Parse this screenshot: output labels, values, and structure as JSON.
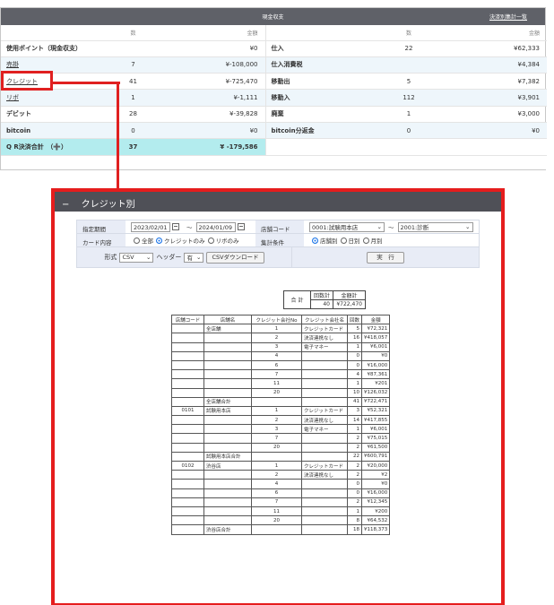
{
  "summary": {
    "title": "現金収支",
    "link": "決済別集計一覧",
    "col_count": "数",
    "col_amount": "金額",
    "left": [
      {
        "label": "使用ポイント（現金収支）",
        "count": "",
        "amount": "¥0"
      },
      {
        "label": "売掛",
        "count": "7",
        "amount": "¥-108,000"
      },
      {
        "label": "クレジット",
        "count": "41",
        "amount": "¥-725,470"
      },
      {
        "label": "リボ",
        "count": "1",
        "amount": "¥-1,111"
      },
      {
        "label": "デビット",
        "count": "28",
        "amount": "¥-39,828"
      },
      {
        "label": "bitcoin",
        "count": "0",
        "amount": "¥0"
      },
      {
        "label": "Q R決済合計　（➕）",
        "count": "37",
        "amount": "¥ -179,586"
      }
    ],
    "right": [
      {
        "label": "仕入",
        "count": "22",
        "amount": "¥62,333"
      },
      {
        "label": "仕入消費税",
        "count": "",
        "amount": "¥4,384"
      },
      {
        "label": "移動出",
        "count": "5",
        "amount": "¥7,382"
      },
      {
        "label": "移動入",
        "count": "112",
        "amount": "¥3,901"
      },
      {
        "label": "廃棄",
        "count": "1",
        "amount": "¥3,000"
      },
      {
        "label": "bitcoin分返金",
        "count": "0",
        "amount": "¥0"
      }
    ]
  },
  "credit": {
    "section_title": "クレジット別",
    "collapse_icon": "minus-icon",
    "filters": {
      "period_label": "指定期間",
      "date_from": "2023/02/01",
      "tilde": "〜",
      "date_to": "2024/01/09",
      "store_code_label": "店舗コード",
      "store_from": "0001:試験用本店",
      "store_to": "2001:診断",
      "card_label": "カード内容",
      "card_options": [
        "全部",
        "クレジットのみ",
        "リボのみ"
      ],
      "agg_label": "集計条件",
      "agg_options": [
        "店舗別",
        "日別",
        "月別"
      ],
      "format_label": "形式",
      "format_value": "CSV",
      "header_label": "ヘッダー",
      "header_value": "有",
      "csv_button": "CSVダウンロード",
      "run_button": "実　行"
    },
    "totals": {
      "label": "合 計",
      "count_label": "回数計",
      "amount_label": "金額計",
      "count": "40",
      "amount": "¥722,470"
    },
    "headers": [
      "店舗コード",
      "店舗名",
      "クレジット会社No",
      "クレジット会社名",
      "回数",
      "金額"
    ],
    "rows": [
      [
        "",
        "全店舗",
        "1",
        "クレジットカード",
        "5",
        "¥72,321"
      ],
      [
        "",
        "",
        "2",
        "決済連携なし",
        "16",
        "¥418,057"
      ],
      [
        "",
        "",
        "3",
        "電子マネー",
        "1",
        "¥6,001"
      ],
      [
        "",
        "",
        "4",
        "",
        "0",
        "¥0"
      ],
      [
        "",
        "",
        "6",
        "",
        "0",
        "¥16,000"
      ],
      [
        "",
        "",
        "7",
        "",
        "4",
        "¥87,361"
      ],
      [
        "",
        "",
        "11",
        "",
        "1",
        "¥201"
      ],
      [
        "",
        "",
        "20",
        "",
        "10",
        "¥126,032"
      ],
      [
        "",
        "全店舗合計",
        "",
        "",
        "41",
        "¥722,471"
      ],
      [
        "0101",
        "試験用本店",
        "1",
        "クレジットカード",
        "3",
        "¥52,321"
      ],
      [
        "",
        "",
        "2",
        "決済連携なし",
        "14",
        "¥417,855"
      ],
      [
        "",
        "",
        "3",
        "電子マネー",
        "1",
        "¥6,001"
      ],
      [
        "",
        "",
        "7",
        "",
        "2",
        "¥75,015"
      ],
      [
        "",
        "",
        "20",
        "",
        "2",
        "¥61,500"
      ],
      [
        "",
        "試験用本店合計",
        "",
        "",
        "22",
        "¥600,791"
      ],
      [
        "0102",
        "渋谷店",
        "1",
        "クレジットカード",
        "2",
        "¥20,000"
      ],
      [
        "",
        "",
        "2",
        "決済連携なし",
        "2",
        "¥2"
      ],
      [
        "",
        "",
        "4",
        "",
        "0",
        "¥0"
      ],
      [
        "",
        "",
        "6",
        "",
        "0",
        "¥16,000"
      ],
      [
        "",
        "",
        "7",
        "",
        "2",
        "¥12,345"
      ],
      [
        "",
        "",
        "11",
        "",
        "1",
        "¥200"
      ],
      [
        "",
        "",
        "20",
        "",
        "8",
        "¥64,532"
      ],
      [
        "",
        "渋谷店合計",
        "",
        "",
        "18",
        "¥118,373"
      ]
    ]
  }
}
